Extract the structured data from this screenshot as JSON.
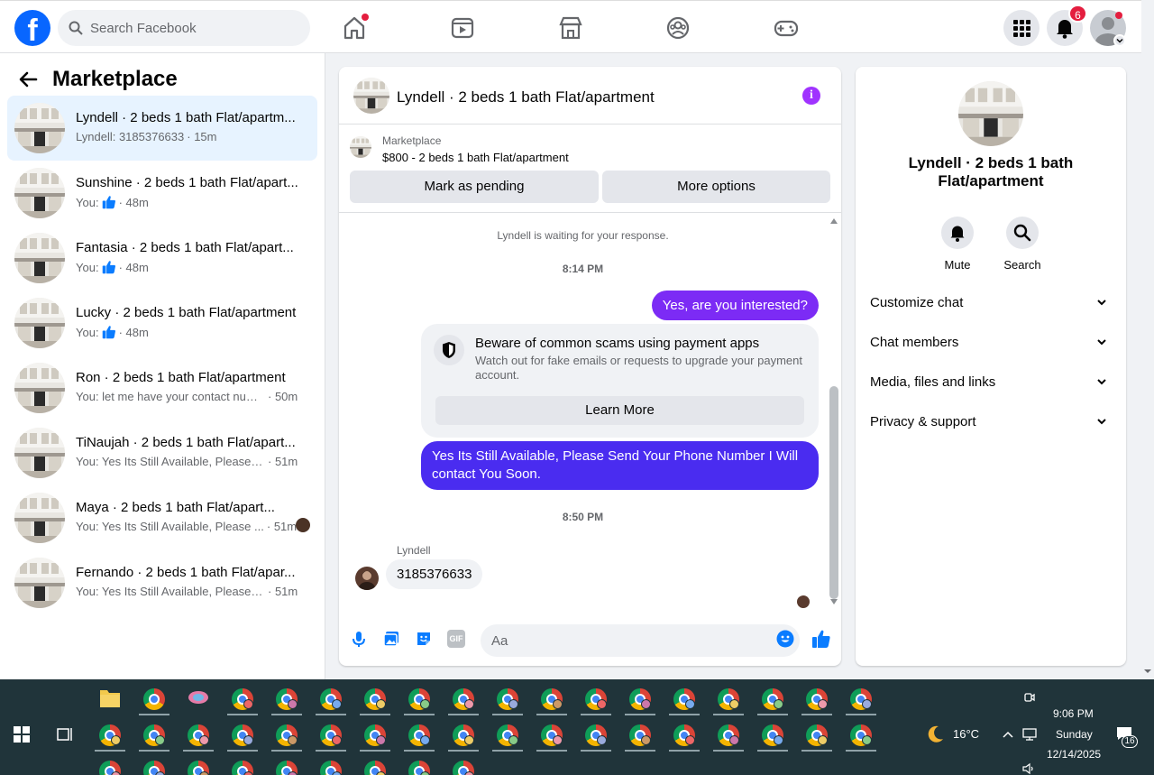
{
  "topbar": {
    "logo_letter": "f",
    "search_placeholder": "Search Facebook",
    "notifications_count": "6",
    "nav_icons": [
      "home-icon",
      "video-icon",
      "marketplace-icon",
      "groups-icon",
      "gaming-icon"
    ]
  },
  "sidebar": {
    "title": "Marketplace",
    "conversations": [
      {
        "title": "Lyndell · 2 beds 1 bath Flat/apartm...",
        "preview": "Lyndell: 3185376633",
        "time": "· 15m",
        "active": true
      },
      {
        "title": "Sunshine · 2 beds 1 bath Flat/apart...",
        "preview": "You:",
        "time": "· 48m",
        "like": true
      },
      {
        "title": "Fantasia · 2 beds 1 bath Flat/apart...",
        "preview": "You:",
        "time": "· 48m",
        "like": true
      },
      {
        "title": "Lucky · 2 beds 1 bath Flat/apartment",
        "preview": "You:",
        "time": "· 48m",
        "like": true
      },
      {
        "title": "Ron · 2 beds 1 bath Flat/apartment",
        "preview": "You: let me have your contact numb...",
        "time": "· 50m"
      },
      {
        "title": "TiNaujah · 2 beds 1 bath Flat/apart...",
        "preview": "You: Yes Its Still Available, Please Se...",
        "time": "· 51m"
      },
      {
        "title": "Maya · 2 beds 1 bath Flat/apart...",
        "preview": "You: Yes Its Still Available, Please ...",
        "time": "· 51m",
        "seen": true
      },
      {
        "title": "Fernando · 2 beds 1 bath Flat/apar...",
        "preview": "You: Yes Its Still Available, Please Se...",
        "time": "· 51m"
      }
    ]
  },
  "chat": {
    "title": "Lyndell · 2 beds 1 bath Flat/apartment",
    "info_glyph": "i",
    "listing_label": "Marketplace",
    "listing_price": "$800 - 2 beds 1 bath Flat/apartment",
    "mark_pending": "Mark as pending",
    "more_options": "More options",
    "waiting_note": "Lyndell is waiting for your response.",
    "time1": "8:14 PM",
    "msg_out1": "Yes, are you interested?",
    "scam_title": "Beware of common scams using payment apps",
    "scam_text": "Watch out for fake emails or requests to upgrade your payment account.",
    "learn_more": "Learn More",
    "msg_out2": "Yes Its Still Available, Please Send Your Phone Number I Will contact You Soon.",
    "time2": "8:50 PM",
    "sender": "Lyndell",
    "msg_in1": "3185376633",
    "input_placeholder": "Aa",
    "gif_label": "GIF"
  },
  "details": {
    "title": "Lyndell · 2 beds 1 bath Flat/apartment",
    "mute": "Mute",
    "search": "Search",
    "sections": [
      "Customize chat",
      "Chat members",
      "Media, files and links",
      "Privacy & support"
    ]
  },
  "taskbar": {
    "weather": "16°C",
    "time": "9:06 PM",
    "day": "Sunday",
    "date": "12/14/2025",
    "notif_count": "16"
  },
  "colors": {
    "facebook_blue": "#0866ff",
    "outgoing_bubble": "#7c2bf5",
    "outgoing_bubble_2": "#4a2cf0",
    "messenger_blue": "#0a7cff",
    "badge_red": "#e41e3f",
    "taskbar": "#20343a"
  }
}
